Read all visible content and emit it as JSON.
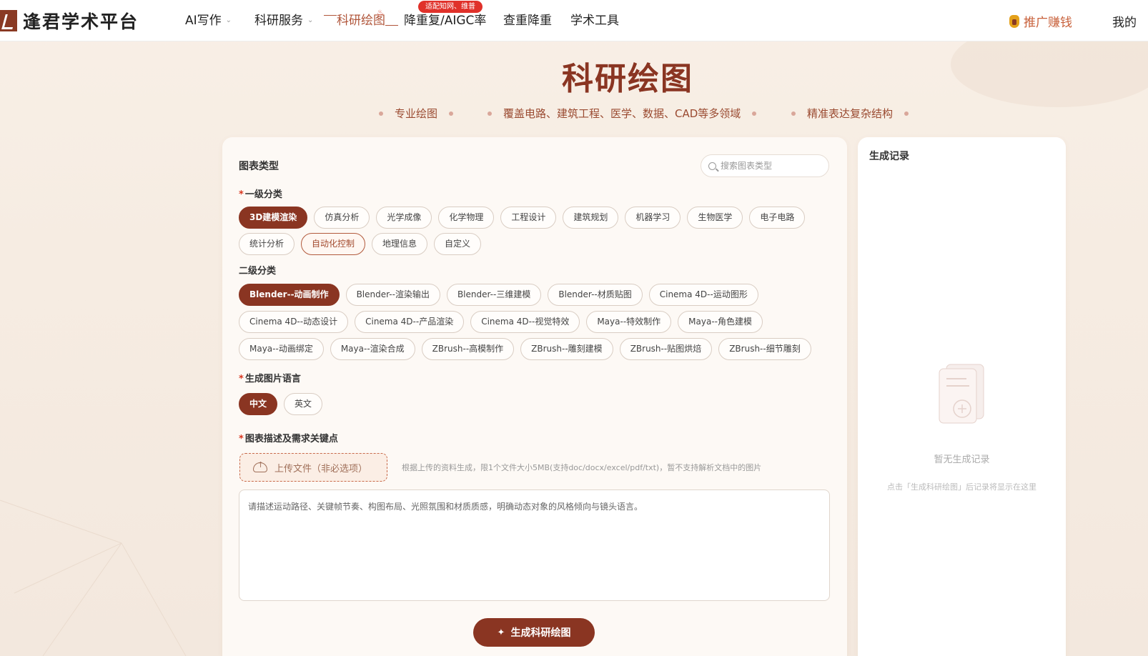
{
  "brand": {
    "name": "逢君学术平台"
  },
  "nav": {
    "items": [
      {
        "label": "AI写作",
        "dropdown": true
      },
      {
        "label": "科研服务",
        "dropdown": true
      },
      {
        "label": "科研绘图",
        "active": true
      },
      {
        "label": "降重复/AIGC率"
      },
      {
        "label": "查重降重"
      },
      {
        "label": "学术工具"
      }
    ],
    "hot_badge": "适配知网、维普",
    "promo": "推广赚钱",
    "mine": "我的"
  },
  "hero": {
    "title": "科研绘图",
    "features": [
      "专业绘图",
      "覆盖电路、建筑工程、医学、数据、CAD等多领域",
      "精准表达复杂结构"
    ]
  },
  "form": {
    "section_title": "图表类型",
    "search_placeholder": "搜索图表类型",
    "level1_label": "一级分类",
    "level1": [
      "3D建模渲染",
      "仿真分析",
      "光学成像",
      "化学物理",
      "工程设计",
      "建筑规划",
      "机器学习",
      "生物医学",
      "电子电路",
      "统计分析",
      "自动化控制",
      "地理信息",
      "自定义"
    ],
    "level1_selected": "3D建模渲染",
    "level2_label": "二级分类",
    "level2": [
      "Blender--动画制作",
      "Blender--渲染输出",
      "Blender--三维建模",
      "Blender--材质贴图",
      "Cinema 4D--运动图形",
      "Cinema 4D--动态设计",
      "Cinema 4D--产品渲染",
      "Cinema 4D--视觉特效",
      "Maya--特效制作",
      "Maya--角色建模",
      "Maya--动画绑定",
      "Maya--渲染合成",
      "ZBrush--高模制作",
      "ZBrush--雕刻建模",
      "ZBrush--贴图烘焙",
      "ZBrush--细节雕刻"
    ],
    "level2_selected": "Blender--动画制作",
    "lang_label": "生成图片语言",
    "langs": [
      "中文",
      "英文"
    ],
    "lang_selected": "中文",
    "desc_label": "图表描述及需求关键点",
    "upload_label": "上传文件（非必选项）",
    "upload_hint": "根据上传的资料生成，限1个文件大小5MB(支持doc/docx/excel/pdf/txt)，暂不支持解析文档中的图片",
    "desc_placeholder": "请描述运动路径、关键帧节奏、构图布局、光照氛围和材质质感，明确动态对象的风格倾向与镜头语言。",
    "generate_label": "生成科研绘图"
  },
  "history": {
    "title": "生成记录",
    "empty_text": "暂无生成记录",
    "empty_hint": "点击「生成科研绘图」后记录将显示在这里"
  },
  "colors": {
    "accent": "#8a3522",
    "nav_active": "#b0553a",
    "badge": "#e0312a"
  }
}
